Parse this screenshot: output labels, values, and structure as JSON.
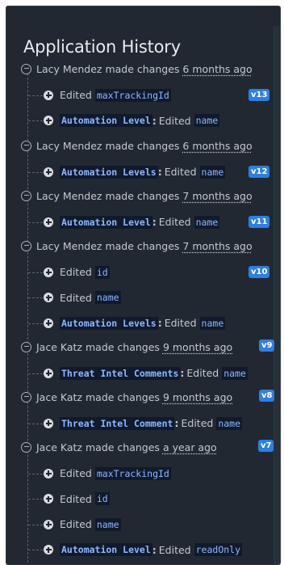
{
  "panel": {
    "title": "Application History"
  },
  "groups": [
    {
      "author": "Lacy Mendez",
      "action": "made changes",
      "ago": "6 months ago",
      "version": "v13",
      "entries": [
        {
          "prefix": "Edited",
          "section": "",
          "field": "maxTrackingId"
        },
        {
          "prefix": "",
          "section": "Automation Level",
          "edited": "Edited",
          "field": "name"
        }
      ]
    },
    {
      "author": "Lacy Mendez",
      "action": "made changes",
      "ago": "6 months ago",
      "version": "v12",
      "entries": [
        {
          "prefix": "",
          "section": "Automation Levels",
          "edited": "Edited",
          "field": "name"
        }
      ]
    },
    {
      "author": "Lacy Mendez",
      "action": "made changes",
      "ago": "7 months ago",
      "version": "v11",
      "entries": [
        {
          "prefix": "",
          "section": "Automation Level",
          "edited": "Edited",
          "field": "name"
        }
      ]
    },
    {
      "author": "Lacy Mendez",
      "action": "made changes",
      "ago": "7 months ago",
      "version": "v10",
      "entries": [
        {
          "prefix": "Edited",
          "section": "",
          "field": "id"
        },
        {
          "prefix": "Edited",
          "section": "",
          "field": "name"
        },
        {
          "prefix": "",
          "section": "Automation Levels",
          "edited": "Edited",
          "field": "name"
        }
      ]
    },
    {
      "author": "Jace Katz",
      "action": "made changes",
      "ago": "9 months ago",
      "version": "v9",
      "entries": [
        {
          "prefix": "",
          "section": "Threat Intel Comments",
          "edited": "Edited",
          "field": "name"
        }
      ]
    },
    {
      "author": "Jace Katz",
      "action": "made changes",
      "ago": "9 months ago",
      "version": "v8",
      "entries": [
        {
          "prefix": "",
          "section": "Threat Intel Comment",
          "edited": "Edited",
          "field": "name"
        }
      ]
    },
    {
      "author": "Jace Katz",
      "action": "made changes",
      "ago": "a year ago",
      "version": "v7",
      "entries": [
        {
          "prefix": "Edited",
          "section": "",
          "field": "maxTrackingId"
        },
        {
          "prefix": "Edited",
          "section": "",
          "field": "id"
        },
        {
          "prefix": "Edited",
          "section": "",
          "field": "name"
        },
        {
          "prefix": "",
          "section": "Automation Level",
          "edited": "Edited",
          "field": "readOnly"
        }
      ]
    }
  ],
  "colors": {
    "background": "#212832",
    "badge": "#2f7fe0",
    "code_bg": "#101a2c",
    "code_text": "#8fb7ff"
  }
}
